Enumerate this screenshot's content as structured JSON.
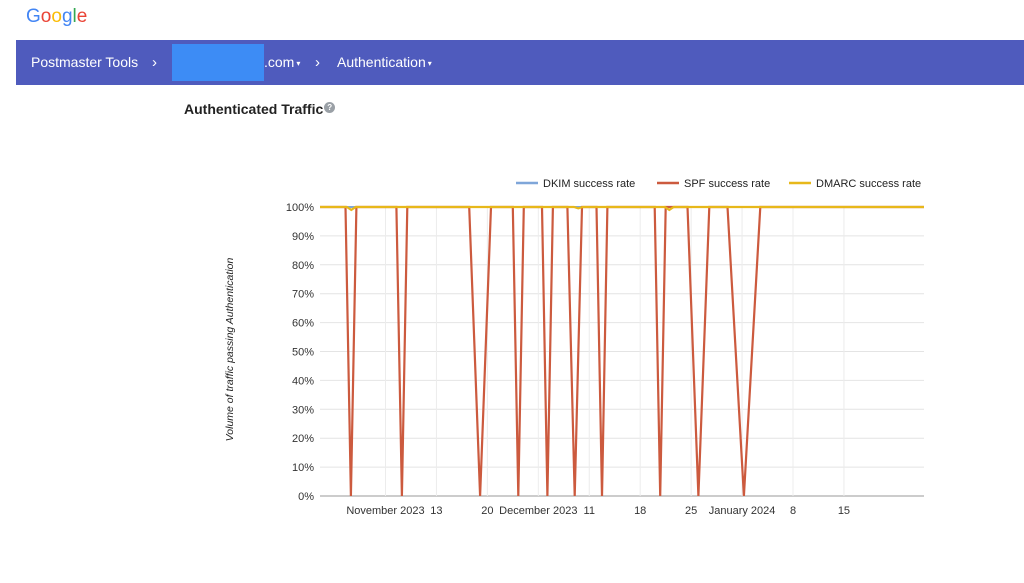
{
  "brand": {
    "name": "Google"
  },
  "topbar": {
    "app_name": "Postmaster Tools",
    "separator": "›",
    "domain_suffix": ".com",
    "page": "Authentication",
    "caret": "▾",
    "color": "#4f5bbd"
  },
  "section": {
    "title": "Authenticated Traffic",
    "help_icon": "?"
  },
  "chart_data": {
    "type": "line",
    "title": "",
    "ylabel": "Volume of traffic passing Authentication",
    "ylim": [
      0,
      100
    ],
    "y_ticks": [
      "0%",
      "10%",
      "20%",
      "30%",
      "40%",
      "50%",
      "60%",
      "70%",
      "80%",
      "90%",
      "100%"
    ],
    "x_tick_labels": [
      "November 2023",
      "13",
      "20",
      "December 2023",
      "11",
      "18",
      "25",
      "January 2024",
      "8",
      "15"
    ],
    "x_tick_days": [
      9,
      16,
      23,
      30,
      37,
      44,
      51,
      58,
      65,
      72
    ],
    "x": [
      0,
      1,
      2,
      3,
      4,
      5,
      6,
      7,
      8,
      9,
      10,
      11,
      12,
      13,
      14,
      15,
      16,
      17,
      18,
      19,
      20,
      21,
      22,
      23,
      24,
      25,
      26,
      27,
      28,
      29,
      30,
      31,
      32,
      33,
      34,
      35,
      36,
      37,
      38,
      39,
      40,
      41,
      42,
      43,
      44,
      45,
      46,
      47,
      48,
      49,
      50,
      51,
      52,
      53,
      54,
      55,
      56,
      57,
      58,
      59,
      60,
      61,
      62,
      63,
      64,
      65,
      66,
      67,
      68,
      69,
      70,
      71,
      72,
      73,
      74,
      75,
      76,
      77,
      78,
      79,
      80,
      81,
      82,
      83
    ],
    "legend_position": "top-right",
    "grid": true,
    "series": [
      {
        "name": "DKIM success rate",
        "color": "#7fa6d9",
        "values": [
          100,
          100,
          100,
          100,
          100,
          100,
          100,
          100,
          100,
          100,
          100,
          100,
          100,
          100,
          100,
          100,
          100,
          100,
          100,
          100,
          100,
          100,
          100,
          100,
          100,
          100,
          100,
          100,
          100,
          100,
          100,
          100,
          100,
          100,
          100,
          100,
          100,
          100,
          100,
          100,
          100,
          100,
          100,
          100,
          100,
          100,
          100,
          100,
          100,
          100,
          100,
          100,
          100,
          100,
          100,
          100,
          100,
          100,
          100,
          100,
          100,
          100,
          100,
          100,
          100,
          100,
          100,
          100,
          100,
          100,
          100,
          100,
          100,
          100,
          100,
          100,
          100,
          100,
          100,
          100,
          100,
          100,
          100,
          100
        ]
      },
      {
        "name": "SPF success rate",
        "color": "#cc5a3e",
        "values": [
          100,
          100,
          100,
          100,
          100,
          100,
          100,
          100,
          100,
          100,
          100,
          100,
          100,
          100,
          100,
          100,
          100,
          100,
          100,
          100,
          100,
          100,
          100,
          100,
          100,
          100,
          100,
          100,
          100,
          100,
          100,
          100,
          100,
          100,
          100,
          100,
          100,
          100,
          100,
          100,
          100,
          100,
          100,
          100,
          100,
          100,
          100,
          100,
          100,
          100,
          100,
          100,
          100,
          100,
          100,
          100,
          100,
          100,
          100,
          100,
          100,
          100,
          100,
          100,
          100,
          100,
          100,
          100,
          100,
          100,
          100,
          100,
          100,
          100,
          100,
          100,
          100,
          100,
          100,
          100,
          100,
          100,
          100,
          100
        ]
      },
      {
        "name": "DMARC success rate",
        "color": "#e7b81a",
        "values": [
          100,
          100,
          100,
          100,
          100,
          100,
          100,
          100,
          100,
          100,
          100,
          100,
          100,
          100,
          100,
          100,
          100,
          100,
          100,
          100,
          100,
          100,
          100,
          100,
          100,
          100,
          100,
          100,
          100,
          100,
          100,
          100,
          100,
          100,
          100,
          100,
          100,
          100,
          100,
          100,
          100,
          100,
          100,
          100,
          100,
          100,
          100,
          100,
          100,
          100,
          100,
          100,
          100,
          100,
          100,
          100,
          100,
          100,
          100,
          100,
          100,
          100,
          100,
          100,
          100,
          100,
          100,
          100,
          100,
          100,
          100,
          100,
          100,
          100,
          100,
          100,
          100,
          100,
          100,
          100,
          100,
          100,
          100,
          100
        ]
      }
    ],
    "spf_dips": [
      [
        3.5,
        0,
        5.0
      ],
      [
        10.5,
        0,
        12.0
      ],
      [
        20.5,
        0,
        23.5
      ],
      [
        26.5,
        0,
        28.0
      ],
      [
        30.5,
        0,
        32.0
      ],
      [
        34.0,
        0,
        36.0
      ],
      [
        38.0,
        0,
        39.5
      ],
      [
        46.0,
        0,
        47.5
      ],
      [
        50.5,
        0,
        53.5
      ],
      [
        56.0,
        0,
        60.5
      ]
    ],
    "dmarc_dips": [
      [
        4.3,
        99
      ],
      [
        35.5,
        99.5
      ],
      [
        48.0,
        99
      ]
    ]
  }
}
